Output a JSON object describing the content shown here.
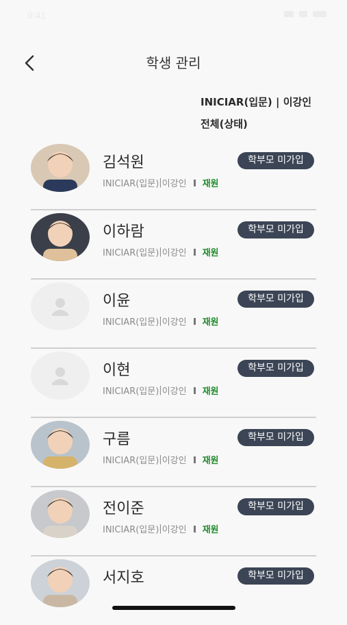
{
  "status_bar": {
    "time": "9:41"
  },
  "header": {
    "title": "학생 관리"
  },
  "filters": {
    "class_teacher": "INICIAR(입문) | 이강인",
    "status": "전체(상태)"
  },
  "colors": {
    "badge_bg": "#3b4555",
    "status_green": "#1f8a2a",
    "divider": "#cfcfcf"
  },
  "students": [
    {
      "name": "김석원",
      "course": "INICIAR(입문)",
      "teacher": "이강인",
      "status": "재원",
      "badge": "학부모 미가입",
      "avatar": "photo"
    },
    {
      "name": "이하람",
      "course": "INICIAR(입문)",
      "teacher": "이강인",
      "status": "재원",
      "badge": "학부모 미가입",
      "avatar": "photo"
    },
    {
      "name": "이윤",
      "course": "INICIAR(입문)",
      "teacher": "이강인",
      "status": "재원",
      "badge": "학부모 미가입",
      "avatar": "placeholder"
    },
    {
      "name": "이현",
      "course": "INICIAR(입문)",
      "teacher": "이강인",
      "status": "재원",
      "badge": "학부모 미가입",
      "avatar": "placeholder"
    },
    {
      "name": "구름",
      "course": "INICIAR(입문)",
      "teacher": "이강인",
      "status": "재원",
      "badge": "학부모 미가입",
      "avatar": "photo"
    },
    {
      "name": "전이준",
      "course": "INICIAR(입문)",
      "teacher": "이강인",
      "status": "재원",
      "badge": "학부모 미가입",
      "avatar": "photo"
    },
    {
      "name": "서지호",
      "course": "",
      "teacher": "",
      "status": "",
      "badge": "학부모 미가입",
      "avatar": "photo"
    }
  ]
}
